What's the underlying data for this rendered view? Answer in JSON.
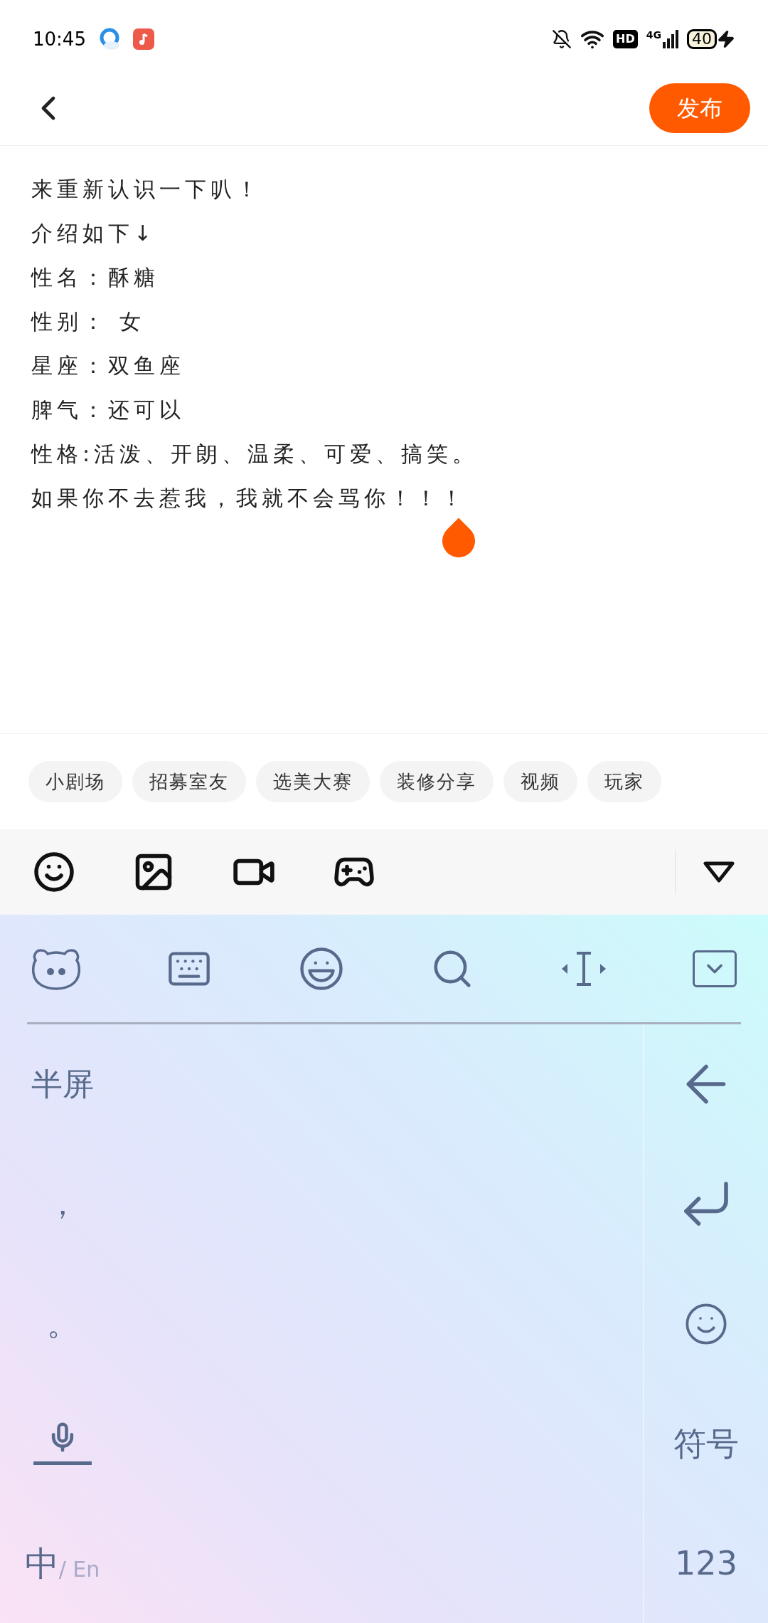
{
  "status_bar": {
    "time": "10:45",
    "hd": "HD",
    "network": "4G",
    "battery": "40"
  },
  "header": {
    "publish_button": "发布"
  },
  "post": {
    "lines": [
      "来重新认识一下叭！",
      "介绍如下↓",
      "性名：酥糖",
      "性别： 女",
      "星座：双鱼座",
      "脾气：还可以",
      "性格:活泼、开朗、温柔、可爱、搞笑。",
      "如果你不去惹我，我就不会骂你！！！"
    ]
  },
  "tags": [
    {
      "label": "小剧场"
    },
    {
      "label": "招募室友"
    },
    {
      "label": "选美大赛"
    },
    {
      "label": "装修分享"
    },
    {
      "label": "视频"
    },
    {
      "label": "玩家"
    }
  ],
  "keyboard": {
    "left_keys": [
      {
        "kind": "text",
        "label": "半屏"
      },
      {
        "kind": "text",
        "label": "，"
      },
      {
        "kind": "text",
        "label": "。"
      },
      {
        "kind": "mic"
      },
      {
        "kind": "lang",
        "label": "中",
        "alt": "/ En"
      }
    ],
    "right_keys": [
      {
        "kind": "backspace"
      },
      {
        "kind": "enter"
      },
      {
        "kind": "emoji"
      },
      {
        "kind": "text",
        "label": "符号"
      },
      {
        "kind": "text",
        "label": "123"
      }
    ]
  }
}
